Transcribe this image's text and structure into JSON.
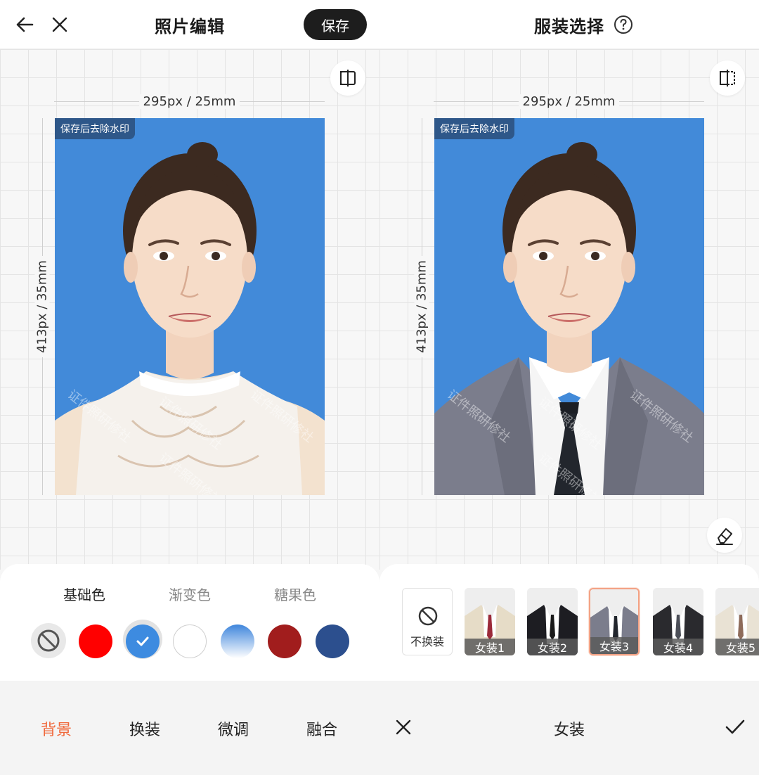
{
  "left": {
    "title": "照片编辑",
    "save_label": "保存",
    "dim_width": "295px / 25mm",
    "dim_height": "413px / 35mm",
    "watermark_tag": "保存后去除水印",
    "watermark_text": "证件照研修社",
    "color_tabs": [
      "基础色",
      "渐变色",
      "糖果色"
    ],
    "swatch_colors": [
      "#ff0000",
      "#3d8be0",
      "#ffffff",
      "#1f4f86",
      "#a11d1d",
      "#2c4f8e"
    ],
    "bottom_tabs": [
      "背景",
      "换装",
      "微调",
      "融合"
    ],
    "accent": "#f0683b"
  },
  "right": {
    "title": "服装选择",
    "dim_width": "295px / 25mm",
    "dim_height": "413px / 35mm",
    "watermark_tag": "保存后去除水印",
    "watermark_text": "证件照研修社",
    "no_change_label": "不换装",
    "outfits": [
      "女装1",
      "女装2",
      "女装3",
      "女装4",
      "女装5"
    ],
    "footer_label": "女装"
  }
}
